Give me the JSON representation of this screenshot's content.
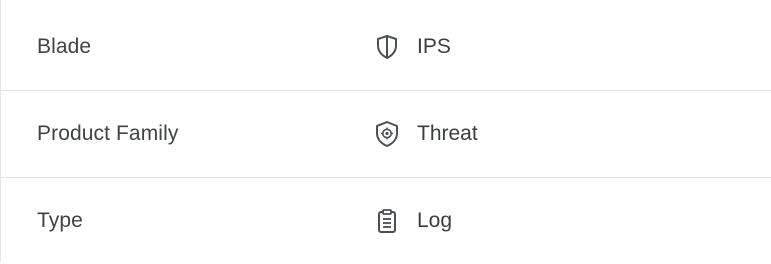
{
  "details": {
    "rows": [
      {
        "label": "Blade",
        "value": "IPS",
        "icon": "shield-icon"
      },
      {
        "label": "Product Family",
        "value": "Threat",
        "icon": "threat-shield-icon"
      },
      {
        "label": "Type",
        "value": "Log",
        "icon": "log-clipboard-icon"
      }
    ]
  },
  "colors": {
    "text": "#3f4348",
    "icon": "#4a4f55",
    "divider": "#dfe2e6"
  }
}
